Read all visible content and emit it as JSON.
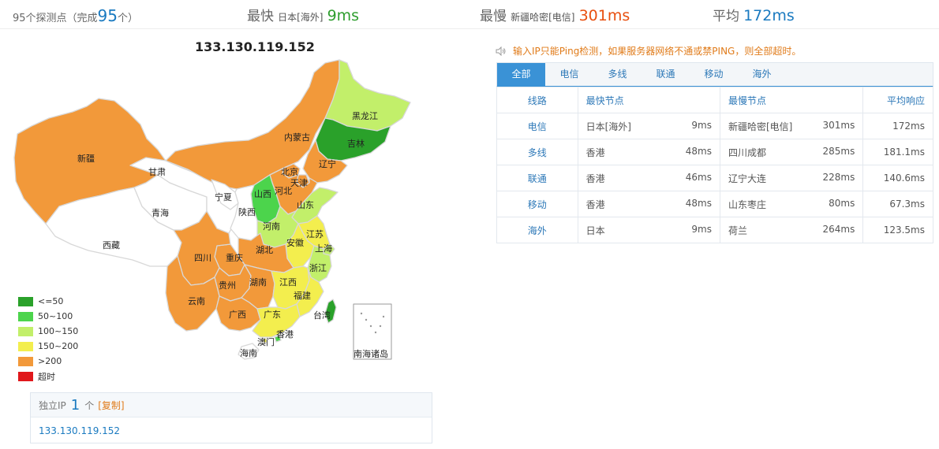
{
  "summary": {
    "points_prefix": "95个探测点（完成",
    "points_done": "95",
    "points_suffix": "个）",
    "fastest_label": "最快",
    "fastest_loc": "日本[海外]",
    "fastest_val": "9ms",
    "slowest_label": "最慢",
    "slowest_loc": "新疆哈密[电信]",
    "slowest_val": "301ms",
    "avg_label": "平均",
    "avg_val": "172ms"
  },
  "map": {
    "ip_title": "133.130.119.152",
    "colors": {
      "le50": "#2aa12a",
      "r50_100": "#4cd44c",
      "r100_150": "#c2ef6a",
      "r150_200": "#f3ee4e",
      "gt200": "#f2993a",
      "timeout": "#e0171b",
      "nodata": "#ffffff"
    },
    "provinces": {
      "xinjiang": "新疆",
      "xizang": "西藏",
      "qinghai": "青海",
      "gansu": "甘肃",
      "neimenggu": "内蒙古",
      "heilongjiang": "黑龙江",
      "jilin": "吉林",
      "liaoning": "辽宁",
      "beijing": "北京",
      "tianjin": "天津",
      "hebei": "河北",
      "shanxi": "山西",
      "ningxia": "宁夏",
      "shaanxi": "陕西",
      "shandong": "山东",
      "henan": "河南",
      "jiangsu": "江苏",
      "anhui": "安徽",
      "shanghai": "上海",
      "zhejiang": "浙江",
      "hubei": "湖北",
      "sichuan": "四川",
      "chongqing": "重庆",
      "guizhou": "贵州",
      "hunan": "湖南",
      "jiangxi": "江西",
      "fujian": "福建",
      "yunnan": "云南",
      "guangxi": "广西",
      "guangdong": "广东",
      "taiwan": "台湾",
      "hongkong": "香港",
      "macau": "澳门",
      "hainan": "海南",
      "nanhai": "南海诸岛"
    },
    "legend": [
      "<=50",
      "50~100",
      "100~150",
      "150~200",
      ">200",
      "超时"
    ]
  },
  "ipbox": {
    "label": "独立IP",
    "count": "1",
    "unit": "个",
    "copy": "[复制]",
    "ip": "133.130.119.152"
  },
  "notice": "输入IP只能Ping检测，如果服务器网络不通或禁PING，则全部超时。",
  "tabs": [
    "全部",
    "电信",
    "多线",
    "联通",
    "移动",
    "海外"
  ],
  "table": {
    "headers": [
      "线路",
      "最快节点",
      "最慢节点",
      "平均响应"
    ],
    "rows": [
      {
        "line": "电信",
        "fast_node": "日本[海外]",
        "fast_ms": "9ms",
        "slow_node": "新疆哈密[电信]",
        "slow_ms": "301ms",
        "avg": "172ms"
      },
      {
        "line": "多线",
        "fast_node": "香港",
        "fast_ms": "48ms",
        "slow_node": "四川成都",
        "slow_ms": "285ms",
        "avg": "181.1ms"
      },
      {
        "line": "联通",
        "fast_node": "香港",
        "fast_ms": "46ms",
        "slow_node": "辽宁大连",
        "slow_ms": "228ms",
        "avg": "140.6ms"
      },
      {
        "line": "移动",
        "fast_node": "香港",
        "fast_ms": "48ms",
        "slow_node": "山东枣庄",
        "slow_ms": "80ms",
        "avg": "67.3ms"
      },
      {
        "line": "海外",
        "fast_node": "日本",
        "fast_ms": "9ms",
        "slow_node": "荷兰",
        "slow_ms": "264ms",
        "avg": "123.5ms"
      }
    ]
  }
}
